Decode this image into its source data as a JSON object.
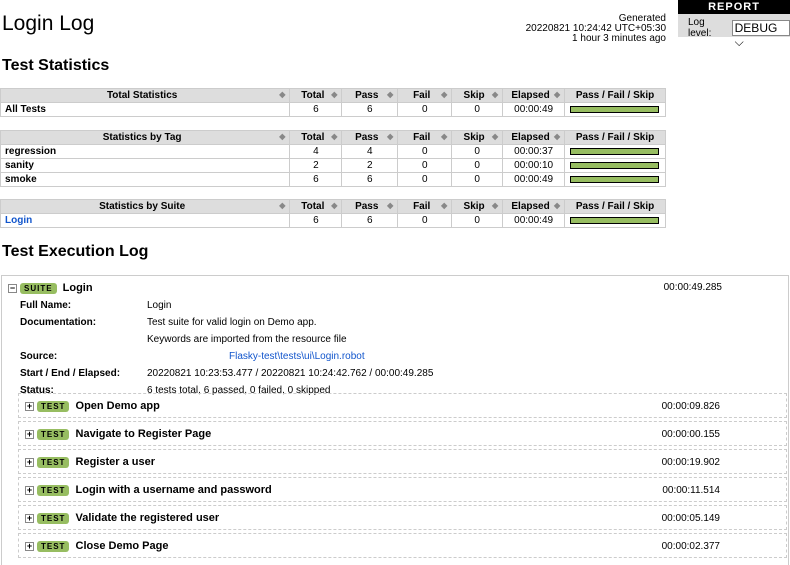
{
  "title": "Login Log",
  "generated": {
    "label": "Generated",
    "timestamp": "20220821 10:24:42 UTC+05:30",
    "ago": "1 hour 3 minutes ago"
  },
  "report": {
    "label": "REPORT",
    "log_level_label": "Log level:",
    "log_level": "DEBUG"
  },
  "headings": {
    "stats": "Test Statistics",
    "exec": "Test Execution Log"
  },
  "columns": [
    "Total",
    "Pass",
    "Fail",
    "Skip",
    "Elapsed",
    "Pass / Fail / Skip"
  ],
  "total_stats": {
    "header": "Total Statistics",
    "rows": [
      {
        "name": "All Tests",
        "total": "6",
        "pass": "6",
        "fail": "0",
        "skip": "0",
        "elapsed": "00:00:49",
        "pass_ratio": 1
      }
    ]
  },
  "tag_stats": {
    "header": "Statistics by Tag",
    "rows": [
      {
        "name": "regression",
        "total": "4",
        "pass": "4",
        "fail": "0",
        "skip": "0",
        "elapsed": "00:00:37",
        "pass_ratio": 1
      },
      {
        "name": "sanity",
        "total": "2",
        "pass": "2",
        "fail": "0",
        "skip": "0",
        "elapsed": "00:00:10",
        "pass_ratio": 1
      },
      {
        "name": "smoke",
        "total": "6",
        "pass": "6",
        "fail": "0",
        "skip": "0",
        "elapsed": "00:00:49",
        "pass_ratio": 1
      }
    ]
  },
  "suite_stats": {
    "header": "Statistics by Suite",
    "rows": [
      {
        "name": "Login",
        "total": "6",
        "pass": "6",
        "fail": "0",
        "skip": "0",
        "elapsed": "00:00:49",
        "pass_ratio": 1
      }
    ]
  },
  "suite": {
    "badge": "SUITE",
    "name": "Login",
    "elapsed": "00:00:49.285",
    "meta": [
      {
        "k": "Full Name:",
        "v": "Login"
      },
      {
        "k": "Documentation:",
        "v": "Test suite for valid login on Demo app."
      },
      {
        "k": "",
        "v": "Keywords are imported from the resource file"
      },
      {
        "k": "Source:",
        "v": "Flasky-test\\tests\\ui\\Login.robot",
        "link": true
      },
      {
        "k": "Start / End / Elapsed:",
        "v": "20220821 10:23:53.477 / 20220821 10:24:42.762 / 00:00:49.285"
      },
      {
        "k": "Status:",
        "v": "6 tests total, 6 passed, 0 failed, 0 skipped"
      }
    ]
  },
  "tests": [
    {
      "badge": "TEST",
      "name": "Open Demo app",
      "elapsed": "00:00:09.826"
    },
    {
      "badge": "TEST",
      "name": "Navigate to Register Page",
      "elapsed": "00:00:00.155"
    },
    {
      "badge": "TEST",
      "name": "Register a user",
      "elapsed": "00:00:19.902"
    },
    {
      "badge": "TEST",
      "name": "Login with a username and password",
      "elapsed": "00:00:11.514"
    },
    {
      "badge": "TEST",
      "name": "Validate the registered user",
      "elapsed": "00:00:05.149"
    },
    {
      "badge": "TEST",
      "name": "Close Demo Page",
      "elapsed": "00:00:02.377"
    }
  ],
  "colors": {
    "pass": "#97bd61"
  }
}
